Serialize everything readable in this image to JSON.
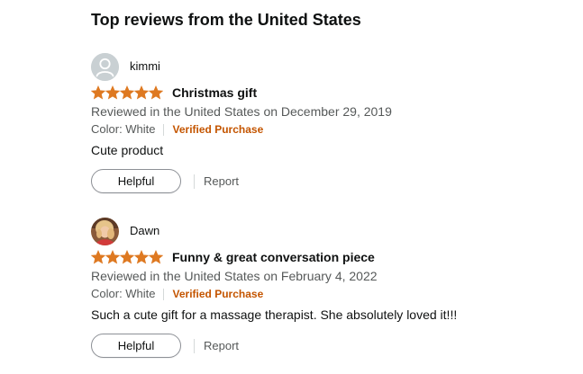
{
  "section": {
    "title": "Top reviews from the United States"
  },
  "colors": {
    "star": "#de7921",
    "verified": "#c45500",
    "muted_text": "#565959"
  },
  "reviews": [
    {
      "author": "kimmi",
      "avatar": "default-avatar-icon",
      "rating": 5,
      "title": "Christmas gift",
      "date_line": "Reviewed in the United States on December 29, 2019",
      "color_label": "Color: White",
      "verified_label": "Verified Purchase",
      "body": "Cute product",
      "helpful_label": "Helpful",
      "report_label": "Report"
    },
    {
      "author": "Dawn",
      "avatar": "profile-photo",
      "rating": 5,
      "title": "Funny & great conversation piece",
      "date_line": "Reviewed in the United States on February 4, 2022",
      "color_label": "Color: White",
      "verified_label": "Verified Purchase",
      "body": "Such a cute gift for a massage therapist. She absolutely loved it!!!",
      "helpful_label": "Helpful",
      "report_label": "Report"
    }
  ]
}
